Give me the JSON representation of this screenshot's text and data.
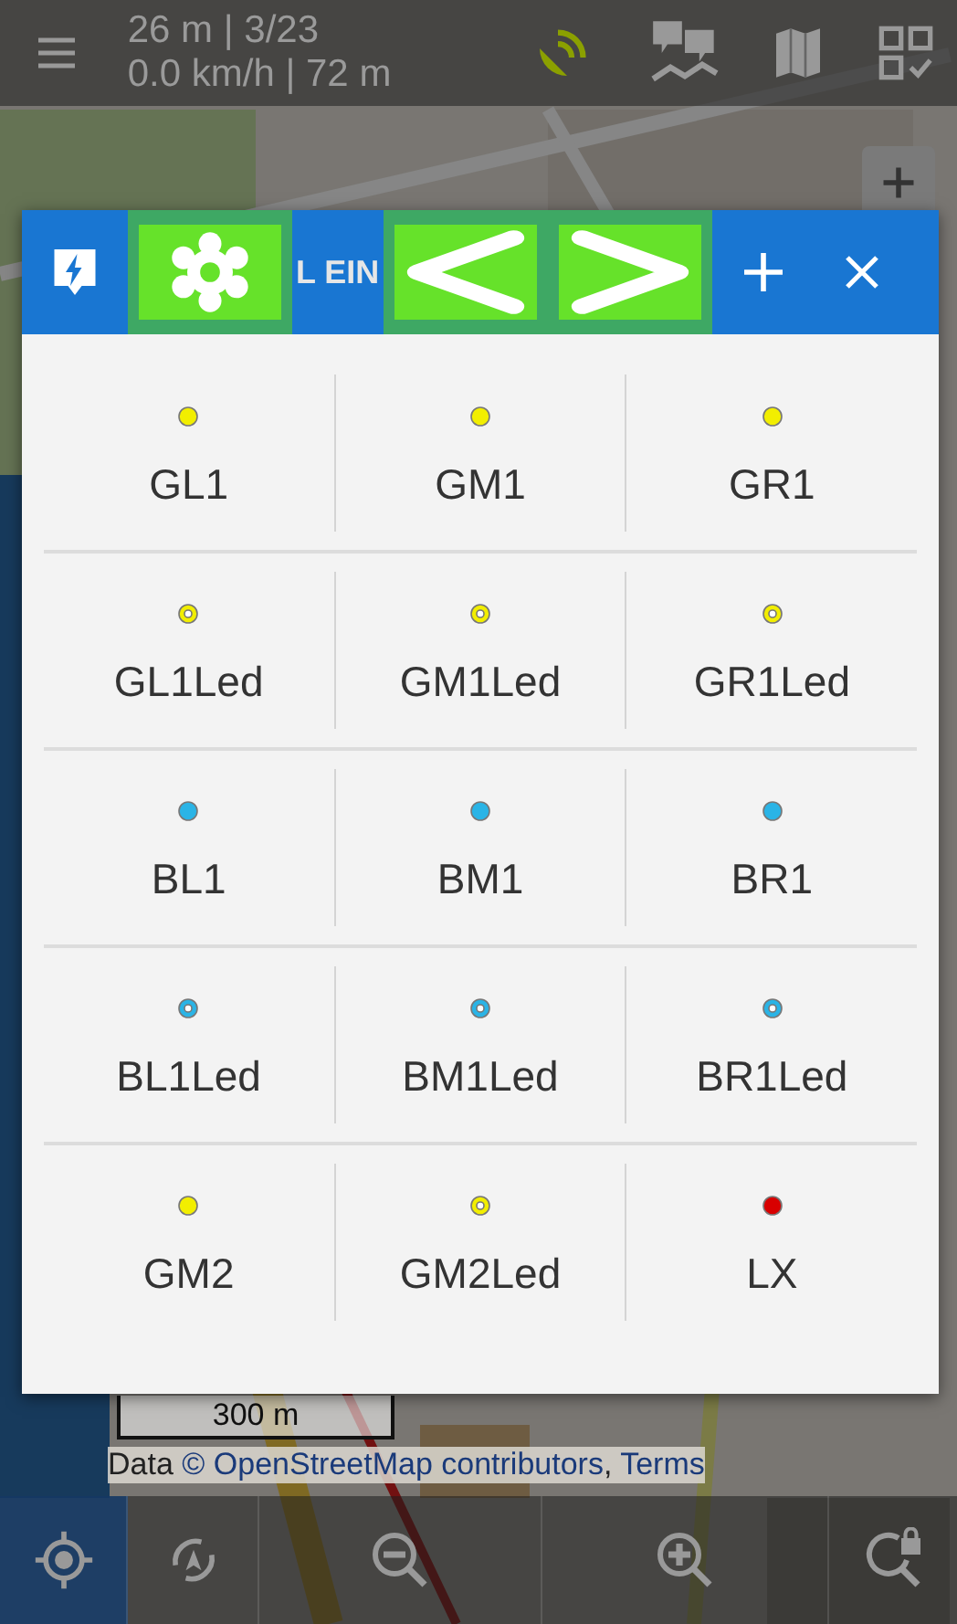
{
  "status": {
    "line_1": "26 m | 3/23",
    "line_2": "0.0 km/h | 72 m"
  },
  "dialog": {
    "title": "L EIN",
    "header_buttons": [
      {
        "kind": "gear",
        "highlighted": true
      },
      {
        "kind": "prev",
        "highlighted": true
      },
      {
        "kind": "next",
        "highlighted": true
      },
      {
        "kind": "add",
        "highlighted": false
      },
      {
        "kind": "close",
        "highlighted": false
      }
    ],
    "items": [
      {
        "label": "GL1",
        "kind": "solid",
        "color": "#f2ee00"
      },
      {
        "label": "GM1",
        "kind": "solid",
        "color": "#f2ee00"
      },
      {
        "label": "GR1",
        "kind": "solid",
        "color": "#f2ee00"
      },
      {
        "label": "GL1Led",
        "kind": "led",
        "color": "#f2ee00"
      },
      {
        "label": "GM1Led",
        "kind": "led",
        "color": "#f2ee00"
      },
      {
        "label": "GR1Led",
        "kind": "led",
        "color": "#f2ee00"
      },
      {
        "label": "BL1",
        "kind": "solid",
        "color": "#2ab4e6"
      },
      {
        "label": "BM1",
        "kind": "solid",
        "color": "#2ab4e6"
      },
      {
        "label": "BR1",
        "kind": "solid",
        "color": "#2ab4e6"
      },
      {
        "label": "BL1Led",
        "kind": "led",
        "color": "#2ab4e6"
      },
      {
        "label": "BM1Led",
        "kind": "led",
        "color": "#2ab4e6"
      },
      {
        "label": "BR1Led",
        "kind": "led",
        "color": "#2ab4e6"
      },
      {
        "label": "GM2",
        "kind": "solid",
        "color": "#f2ee00"
      },
      {
        "label": "GM2Led",
        "kind": "led",
        "color": "#f2ee00"
      },
      {
        "label": "LX",
        "kind": "solid",
        "color": "#d80000"
      }
    ]
  },
  "scale": "300 m",
  "attribution": {
    "prefix": "Data ",
    "link": "© OpenStreetMap contributors",
    "separator": ", ",
    "terms": "Terms"
  }
}
